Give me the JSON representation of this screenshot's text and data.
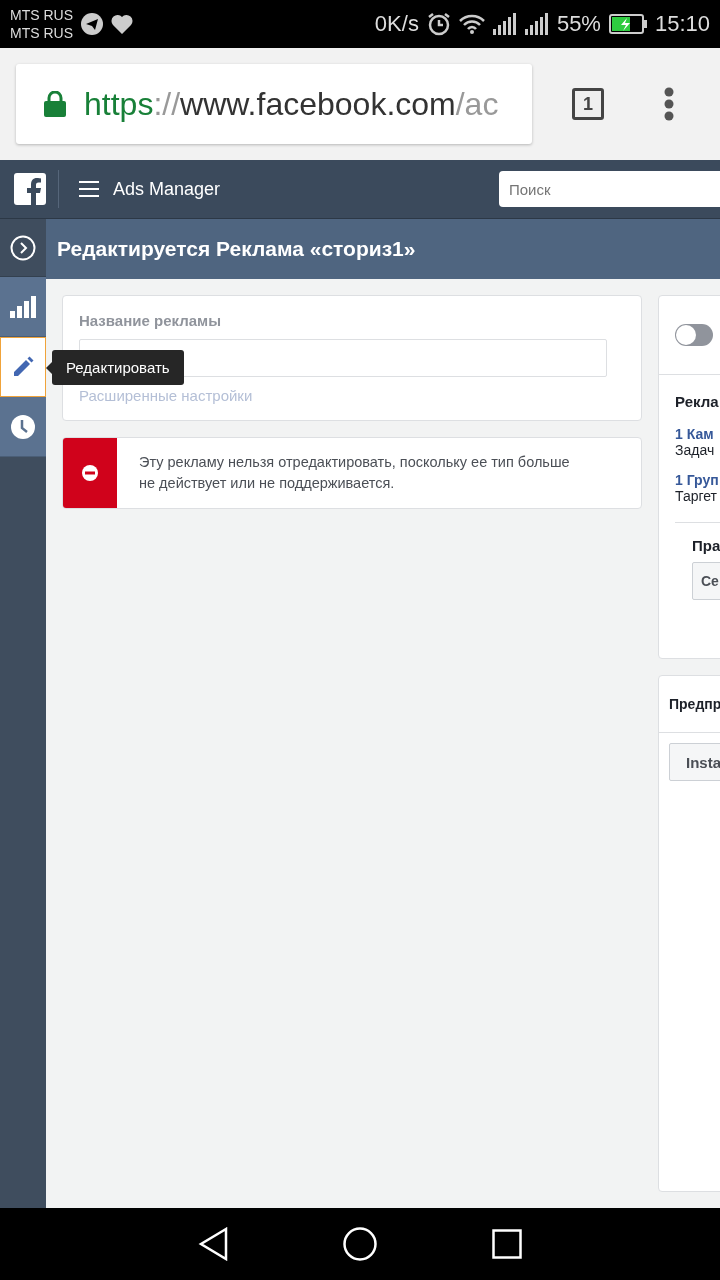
{
  "status_bar": {
    "carriers": [
      "MTS RUS",
      "MTS RUS"
    ],
    "speed": "0K/s",
    "battery": "55%",
    "time": "15:10"
  },
  "browser": {
    "url_scheme": "https",
    "url_separator": "://",
    "url_host": "www.facebook.com",
    "url_path": "/ac",
    "tab_count": "1"
  },
  "header": {
    "title": "Ads Manager",
    "search": {
      "placeholder": "Поиск"
    }
  },
  "page_title": "Редактируется Реклама «сториз1»",
  "sidebar": {
    "items": [
      {
        "kind": "stats",
        "selected": false
      },
      {
        "kind": "edit",
        "selected": true
      },
      {
        "kind": "history",
        "selected": false
      }
    ]
  },
  "tooltip": "Редактировать",
  "ad_name_card": {
    "label": "Название рекламы",
    "link": "Расширенные настройки"
  },
  "error_message": "Эту рекламу нельзя отредактировать, поскольку ее тип больше не действует или не поддерживается.",
  "right_panel": {
    "toggle": {
      "on": false
    },
    "heading": "Рекла",
    "items": [
      {
        "link": "1 Кам",
        "text": "Задач"
      },
      {
        "link": "1 Груп",
        "text": "Таргет"
      }
    ],
    "subheading": "Пра",
    "button": "Се"
  },
  "preview_panel": {
    "heading": "Предпр",
    "button": "Insta"
  }
}
